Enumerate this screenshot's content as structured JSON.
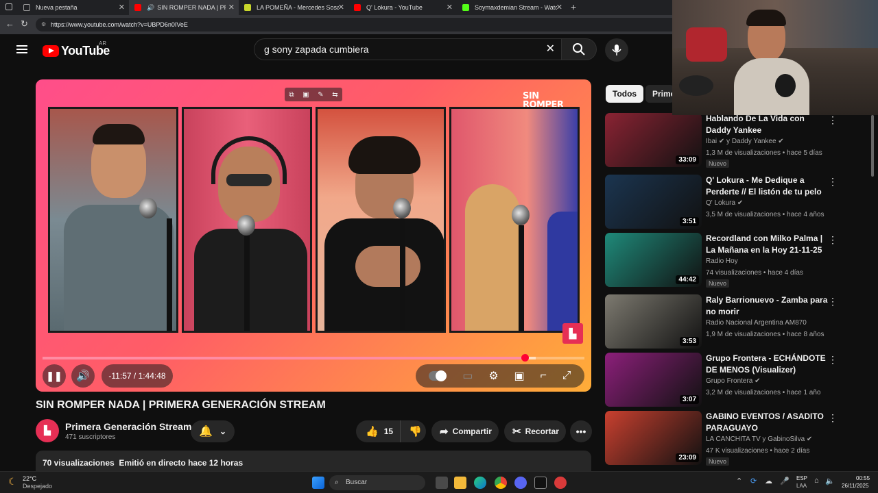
{
  "browser": {
    "tabs": [
      {
        "label": "Nueva pestaña",
        "active": false,
        "favicon": "#5f6368"
      },
      {
        "label": "SIN ROMPER NADA | PRIME",
        "active": true,
        "favicon": "#ff0000"
      },
      {
        "label": "LA POMEÑA - Mercedes Sosa - L",
        "active": false,
        "favicon": "#c8d62b"
      },
      {
        "label": "Q' Lokura - YouTube",
        "active": false,
        "favicon": "#ff0000"
      },
      {
        "label": "Soymaxdemian Stream - Watch L",
        "active": false,
        "favicon": "#53fc18"
      }
    ],
    "url": "https://www.youtube.com/watch?v=UBPD6n0IVeE"
  },
  "masthead": {
    "logo_text": "YouTube",
    "country": "AR",
    "search_value": "g sony zapada cumbiera"
  },
  "player": {
    "overlay_logo": "SIN ROMPER NADA",
    "time_display": "-11:57 / 1:44:48",
    "progress": 0.89,
    "buffered": 0.91
  },
  "video": {
    "title": "SIN ROMPER NADA | PRIMERA GENERACIÓN STREAM",
    "channel": "Primera Generación Stream",
    "subscribers": "471 suscriptores",
    "likes": "15",
    "share_label": "Compartir",
    "clip_label": "Recortar",
    "views_line": "70 visualizaciones  Emitió en directo hace 12 horas"
  },
  "sidebar": {
    "chips": [
      "Todos",
      "Prime"
    ],
    "recommendations": [
      {
        "title": "Hablando De La Vida con Daddy Yankee",
        "channel": "Ibai ✔ y Daddy Yankee ✔",
        "meta": "1,3 M de visualizaciones • hace 5 días",
        "duration": "33:09",
        "badge": "Nuevo",
        "thumb_color": "#8a2333"
      },
      {
        "title": "Q' Lokura - Me Dedique a Perderte // El listón de tu pelo ...",
        "channel": "Q' Lokura ✔",
        "meta": "3,5 M de visualizaciones • hace 4 años",
        "duration": "3:51",
        "badge": "",
        "thumb_color": "#1b3550"
      },
      {
        "title": "Recordland con Milko Palma | La Mañana en la Hoy 21-11-25",
        "channel": "Radio Hoy",
        "meta": "74 visualizaciones • hace 4 días",
        "duration": "44:42",
        "badge": "Nuevo",
        "thumb_color": "#1f8a7a"
      },
      {
        "title": "Raly Barrionuevo - Zamba para no morir",
        "channel": "Radio Nacional Argentina AM870",
        "meta": "1,9 M de visualizaciones • hace 8 años",
        "duration": "3:53",
        "badge": "",
        "thumb_color": "#7d7a70"
      },
      {
        "title": "Grupo Frontera - ECHÁNDOTE DE MENOS (Visualizer)",
        "channel": "Grupo Frontera ✔",
        "meta": "3,2 M de visualizaciones • hace 1 año",
        "duration": "3:07",
        "badge": "",
        "thumb_color": "#8c1f7a"
      },
      {
        "title": "GABINO EVENTOS / ASADITO PARAGUAYO",
        "channel": "LA CANCHITA TV y GabinoSilva ✔",
        "meta": "47 K visualizaciones • hace 2 días",
        "duration": "23:09",
        "badge": "Nuevo",
        "thumb_color": "#c9402f"
      }
    ]
  },
  "taskbar": {
    "weather_temp": "22°C",
    "weather_text": "Despejado",
    "search_placeholder": "Buscar",
    "lang": "ESP",
    "lang_sub": "LAA",
    "time": "00:55",
    "date": "26/11/2025"
  },
  "colors": {
    "accent": "#ff0033",
    "background": "#0f0f0f"
  }
}
